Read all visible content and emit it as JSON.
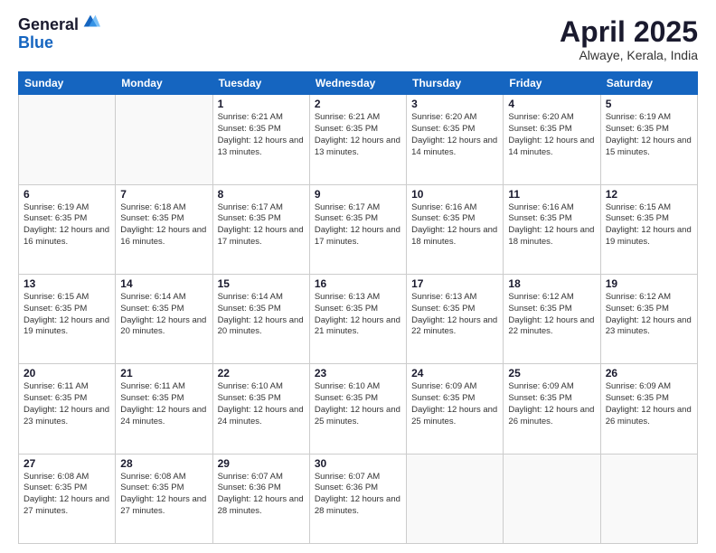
{
  "header": {
    "logo_general": "General",
    "logo_blue": "Blue",
    "month_title": "April 2025",
    "location": "Alwaye, Kerala, India"
  },
  "weekdays": [
    "Sunday",
    "Monday",
    "Tuesday",
    "Wednesday",
    "Thursday",
    "Friday",
    "Saturday"
  ],
  "weeks": [
    [
      {
        "day": "",
        "sunrise": "",
        "sunset": "",
        "daylight": ""
      },
      {
        "day": "",
        "sunrise": "",
        "sunset": "",
        "daylight": ""
      },
      {
        "day": "1",
        "sunrise": "Sunrise: 6:21 AM",
        "sunset": "Sunset: 6:35 PM",
        "daylight": "Daylight: 12 hours and 13 minutes."
      },
      {
        "day": "2",
        "sunrise": "Sunrise: 6:21 AM",
        "sunset": "Sunset: 6:35 PM",
        "daylight": "Daylight: 12 hours and 13 minutes."
      },
      {
        "day": "3",
        "sunrise": "Sunrise: 6:20 AM",
        "sunset": "Sunset: 6:35 PM",
        "daylight": "Daylight: 12 hours and 14 minutes."
      },
      {
        "day": "4",
        "sunrise": "Sunrise: 6:20 AM",
        "sunset": "Sunset: 6:35 PM",
        "daylight": "Daylight: 12 hours and 14 minutes."
      },
      {
        "day": "5",
        "sunrise": "Sunrise: 6:19 AM",
        "sunset": "Sunset: 6:35 PM",
        "daylight": "Daylight: 12 hours and 15 minutes."
      }
    ],
    [
      {
        "day": "6",
        "sunrise": "Sunrise: 6:19 AM",
        "sunset": "Sunset: 6:35 PM",
        "daylight": "Daylight: 12 hours and 16 minutes."
      },
      {
        "day": "7",
        "sunrise": "Sunrise: 6:18 AM",
        "sunset": "Sunset: 6:35 PM",
        "daylight": "Daylight: 12 hours and 16 minutes."
      },
      {
        "day": "8",
        "sunrise": "Sunrise: 6:17 AM",
        "sunset": "Sunset: 6:35 PM",
        "daylight": "Daylight: 12 hours and 17 minutes."
      },
      {
        "day": "9",
        "sunrise": "Sunrise: 6:17 AM",
        "sunset": "Sunset: 6:35 PM",
        "daylight": "Daylight: 12 hours and 17 minutes."
      },
      {
        "day": "10",
        "sunrise": "Sunrise: 6:16 AM",
        "sunset": "Sunset: 6:35 PM",
        "daylight": "Daylight: 12 hours and 18 minutes."
      },
      {
        "day": "11",
        "sunrise": "Sunrise: 6:16 AM",
        "sunset": "Sunset: 6:35 PM",
        "daylight": "Daylight: 12 hours and 18 minutes."
      },
      {
        "day": "12",
        "sunrise": "Sunrise: 6:15 AM",
        "sunset": "Sunset: 6:35 PM",
        "daylight": "Daylight: 12 hours and 19 minutes."
      }
    ],
    [
      {
        "day": "13",
        "sunrise": "Sunrise: 6:15 AM",
        "sunset": "Sunset: 6:35 PM",
        "daylight": "Daylight: 12 hours and 19 minutes."
      },
      {
        "day": "14",
        "sunrise": "Sunrise: 6:14 AM",
        "sunset": "Sunset: 6:35 PM",
        "daylight": "Daylight: 12 hours and 20 minutes."
      },
      {
        "day": "15",
        "sunrise": "Sunrise: 6:14 AM",
        "sunset": "Sunset: 6:35 PM",
        "daylight": "Daylight: 12 hours and 20 minutes."
      },
      {
        "day": "16",
        "sunrise": "Sunrise: 6:13 AM",
        "sunset": "Sunset: 6:35 PM",
        "daylight": "Daylight: 12 hours and 21 minutes."
      },
      {
        "day": "17",
        "sunrise": "Sunrise: 6:13 AM",
        "sunset": "Sunset: 6:35 PM",
        "daylight": "Daylight: 12 hours and 22 minutes."
      },
      {
        "day": "18",
        "sunrise": "Sunrise: 6:12 AM",
        "sunset": "Sunset: 6:35 PM",
        "daylight": "Daylight: 12 hours and 22 minutes."
      },
      {
        "day": "19",
        "sunrise": "Sunrise: 6:12 AM",
        "sunset": "Sunset: 6:35 PM",
        "daylight": "Daylight: 12 hours and 23 minutes."
      }
    ],
    [
      {
        "day": "20",
        "sunrise": "Sunrise: 6:11 AM",
        "sunset": "Sunset: 6:35 PM",
        "daylight": "Daylight: 12 hours and 23 minutes."
      },
      {
        "day": "21",
        "sunrise": "Sunrise: 6:11 AM",
        "sunset": "Sunset: 6:35 PM",
        "daylight": "Daylight: 12 hours and 24 minutes."
      },
      {
        "day": "22",
        "sunrise": "Sunrise: 6:10 AM",
        "sunset": "Sunset: 6:35 PM",
        "daylight": "Daylight: 12 hours and 24 minutes."
      },
      {
        "day": "23",
        "sunrise": "Sunrise: 6:10 AM",
        "sunset": "Sunset: 6:35 PM",
        "daylight": "Daylight: 12 hours and 25 minutes."
      },
      {
        "day": "24",
        "sunrise": "Sunrise: 6:09 AM",
        "sunset": "Sunset: 6:35 PM",
        "daylight": "Daylight: 12 hours and 25 minutes."
      },
      {
        "day": "25",
        "sunrise": "Sunrise: 6:09 AM",
        "sunset": "Sunset: 6:35 PM",
        "daylight": "Daylight: 12 hours and 26 minutes."
      },
      {
        "day": "26",
        "sunrise": "Sunrise: 6:09 AM",
        "sunset": "Sunset: 6:35 PM",
        "daylight": "Daylight: 12 hours and 26 minutes."
      }
    ],
    [
      {
        "day": "27",
        "sunrise": "Sunrise: 6:08 AM",
        "sunset": "Sunset: 6:35 PM",
        "daylight": "Daylight: 12 hours and 27 minutes."
      },
      {
        "day": "28",
        "sunrise": "Sunrise: 6:08 AM",
        "sunset": "Sunset: 6:35 PM",
        "daylight": "Daylight: 12 hours and 27 minutes."
      },
      {
        "day": "29",
        "sunrise": "Sunrise: 6:07 AM",
        "sunset": "Sunset: 6:36 PM",
        "daylight": "Daylight: 12 hours and 28 minutes."
      },
      {
        "day": "30",
        "sunrise": "Sunrise: 6:07 AM",
        "sunset": "Sunset: 6:36 PM",
        "daylight": "Daylight: 12 hours and 28 minutes."
      },
      {
        "day": "",
        "sunrise": "",
        "sunset": "",
        "daylight": ""
      },
      {
        "day": "",
        "sunrise": "",
        "sunset": "",
        "daylight": ""
      },
      {
        "day": "",
        "sunrise": "",
        "sunset": "",
        "daylight": ""
      }
    ]
  ]
}
